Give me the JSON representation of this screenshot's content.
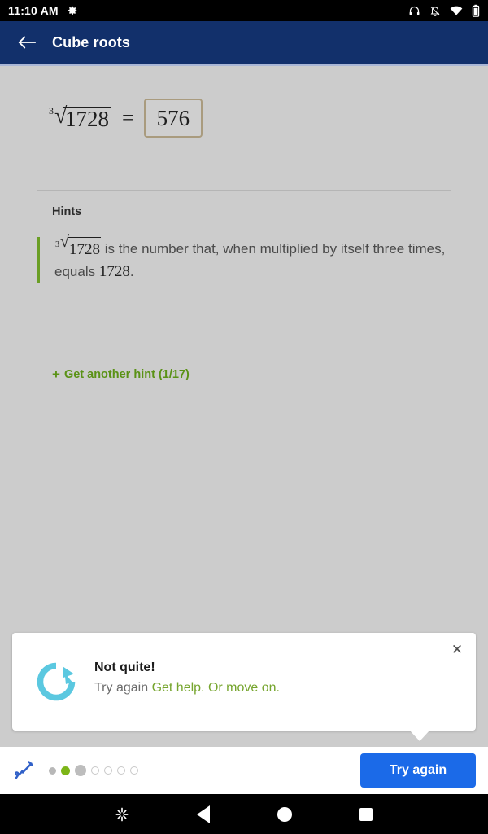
{
  "status_bar": {
    "time": "11:10 AM",
    "gear_icon": "gear-icon",
    "icons": [
      "headphones-icon",
      "bell-off-icon",
      "wifi-icon",
      "battery-icon"
    ]
  },
  "app_bar": {
    "back_icon": "back-arrow-icon",
    "title": "Cube roots",
    "background_color": "#12306b"
  },
  "problem": {
    "radical_index": "3",
    "radicand": "1728",
    "equals": "=",
    "answer_value": "576",
    "answer_border_color": "#a99b7e"
  },
  "hints": {
    "section_label": "Hints",
    "accent_color": "#6a9e24",
    "hint_index": "3",
    "hint_radicand": "1728",
    "hint_text_part1": "is the number that, when multiplied by itself three times, equals",
    "hint_number": "1728",
    "hint_text_end": ".",
    "get_another_hint_plus": "+",
    "get_another_hint_label": "Get another hint (1/17)",
    "get_another_hint_color": "#5a9216"
  },
  "feedback_card": {
    "icon": "refresh-circular-arrow-icon",
    "icon_color": "#5bc8e0",
    "title": "Not quite!",
    "subtitle_prefix": "Try again",
    "link_get_help": "Get help.",
    "link_move_on": "Or move on.",
    "link_color": "#76a52e",
    "close_icon": "close-icon",
    "close_glyph": "✕"
  },
  "bottom_bar": {
    "scratchpad_icon": "scratchpad-pencil-icon",
    "progress_dots": [
      {
        "state": "done-gray"
      },
      {
        "state": "correct-green"
      },
      {
        "state": "current-gray"
      },
      {
        "state": "empty"
      },
      {
        "state": "empty"
      },
      {
        "state": "empty"
      },
      {
        "state": "empty"
      }
    ],
    "primary_button_label": "Try again",
    "primary_button_color": "#1b6ae8"
  },
  "nav_bar": {
    "items": [
      "brightness-asterisk-icon",
      "back-triangle-icon",
      "home-circle-icon",
      "recents-square-icon"
    ]
  }
}
